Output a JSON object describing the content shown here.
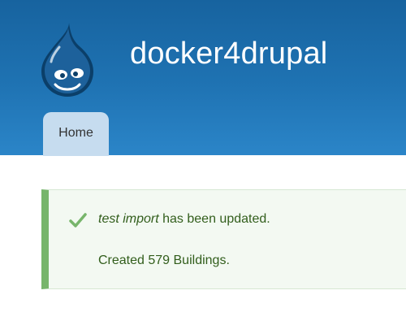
{
  "header": {
    "site_name": "docker4drupal"
  },
  "nav": {
    "tabs": [
      {
        "label": "Home"
      }
    ]
  },
  "status_message": {
    "item_name": "test import",
    "line1_suffix": " has been updated.",
    "line2": "Created 579 Buildings."
  },
  "colors": {
    "header_top": "#17639f",
    "header_bottom": "#2b85c8",
    "tab_active": "#c6dcef",
    "message_background": "#f3f9f2",
    "message_border": "#77b56b",
    "message_text": "#325e1c"
  },
  "icons": {
    "logo": "drupal-drop-logo",
    "status": "check-icon"
  }
}
